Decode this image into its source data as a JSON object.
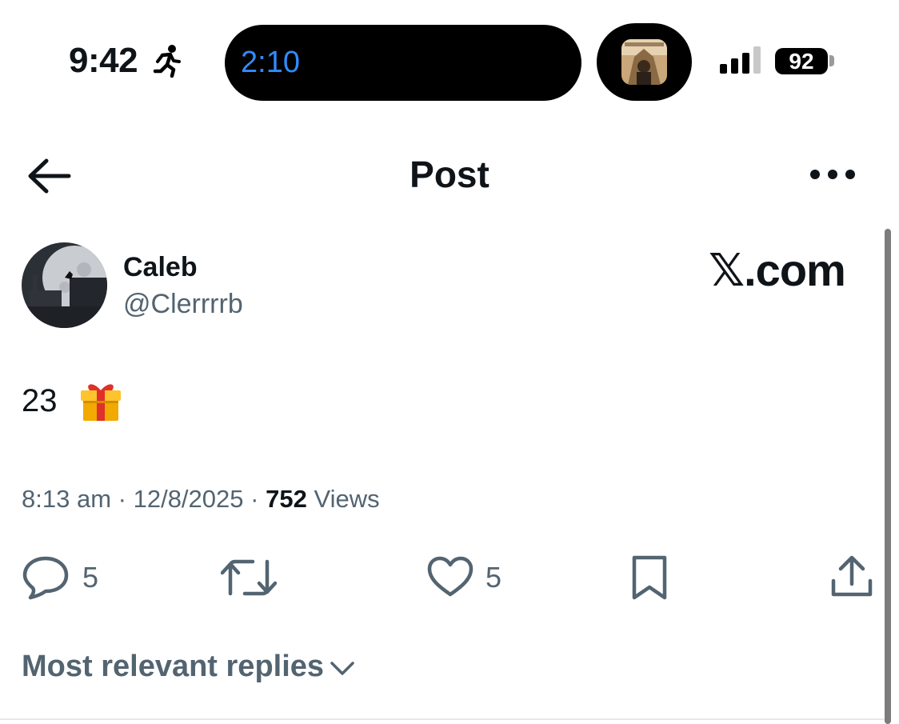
{
  "status_bar": {
    "time": "9:42",
    "activity_icon": "running-figure-icon",
    "live_activity_timer": "2:10",
    "signal_icon": "cellular-signal-icon",
    "battery_level": "92",
    "accent_color": "#2f8cff"
  },
  "nav": {
    "back_icon": "arrow-left-icon",
    "title": "Post",
    "more_icon": "more-horizontal-icon"
  },
  "post": {
    "author": {
      "name": "Caleb",
      "handle": "@Clerrrrb"
    },
    "brand_watermark": "𝕏.com",
    "text": "23",
    "emoji_icon": "wrapped-gift-icon",
    "time": "8:13 am",
    "date": "12/8/2025",
    "views_count": "752",
    "views_label": "Views",
    "separator": "·"
  },
  "actions": {
    "reply": {
      "icon": "reply-bubble-icon",
      "count": "5"
    },
    "repost": {
      "icon": "repost-icon"
    },
    "like": {
      "icon": "heart-icon",
      "count": "5"
    },
    "bookmark": {
      "icon": "bookmark-icon"
    },
    "share": {
      "icon": "share-icon"
    }
  },
  "replies_filter": {
    "label": "Most relevant replies",
    "icon": "chevron-down-icon"
  },
  "colors": {
    "text_primary": "#0f1419",
    "text_secondary": "#536471"
  }
}
